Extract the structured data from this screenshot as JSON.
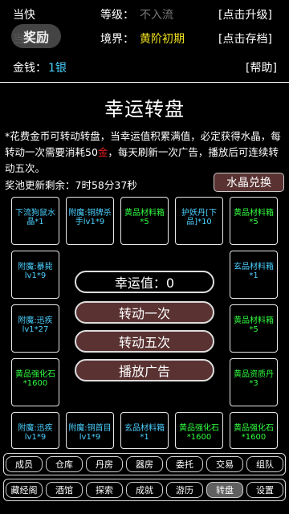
{
  "header": {
    "name_label": "当快",
    "level_label": "等级：",
    "level_value": "不入流",
    "upgrade_button": "[点击升级]",
    "reward_badge": "奖励",
    "row2_left": "当快",
    "realm_label": "境界：",
    "realm_value": "黄阶初期",
    "save_button": "[点击存档]",
    "money_label": "金钱：",
    "money_value": "1银",
    "help_button": "[帮助]"
  },
  "page_title": "幸运转盘",
  "description": {
    "part1": "*花费金币可转动转盘，当幸运值积累满值，必定获得水晶，每转动一次需要消耗50",
    "currency": "金",
    "part2": "，每天刷新一次广告，播放后可连续转动五次。"
  },
  "timer": {
    "label": "奖池更新剩余：",
    "value": "7时58分37秒"
  },
  "crystal_exchange_button": "水晶兑换",
  "wheel": {
    "cells": [
      "下流狗鼠水晶*1",
      "附魔:铜牌杀手lv1*9",
      "黄品材料箱*5",
      "护妖丹[下品]*10",
      "黄品材料箱*5",
      "附魔:暴毙lv1*9",
      "玄品材料箱*1",
      "附魔:迅疾lv1*27",
      "黄品材料箱*5",
      "黄品强化石*1600",
      "黄品资质丹*3",
      "附魔:迅疾lv1*9",
      "附魔:铜首目lv1*9",
      "玄品材料箱*1",
      "黄品强化石*1600",
      "黄品强化石*1600"
    ],
    "luck_label": "幸运值：0",
    "spin_once": "转动一次",
    "spin_five": "转动五次",
    "play_ad": "播放广告"
  },
  "nav": {
    "row1": [
      "成员",
      "仓库",
      "丹房",
      "器房",
      "委托",
      "交易",
      "组队"
    ],
    "row2": [
      "藏经阁",
      "酒馆",
      "探索",
      "成就",
      "游历",
      "转盘",
      "设置"
    ],
    "active": "转盘"
  },
  "colors": {
    "button_fill": "#5a3232",
    "cyan_text": "#4ad0ff",
    "green_text": "#30ff40",
    "pink_text": "#ff80c0",
    "realm_yellow": "#f0e020"
  }
}
